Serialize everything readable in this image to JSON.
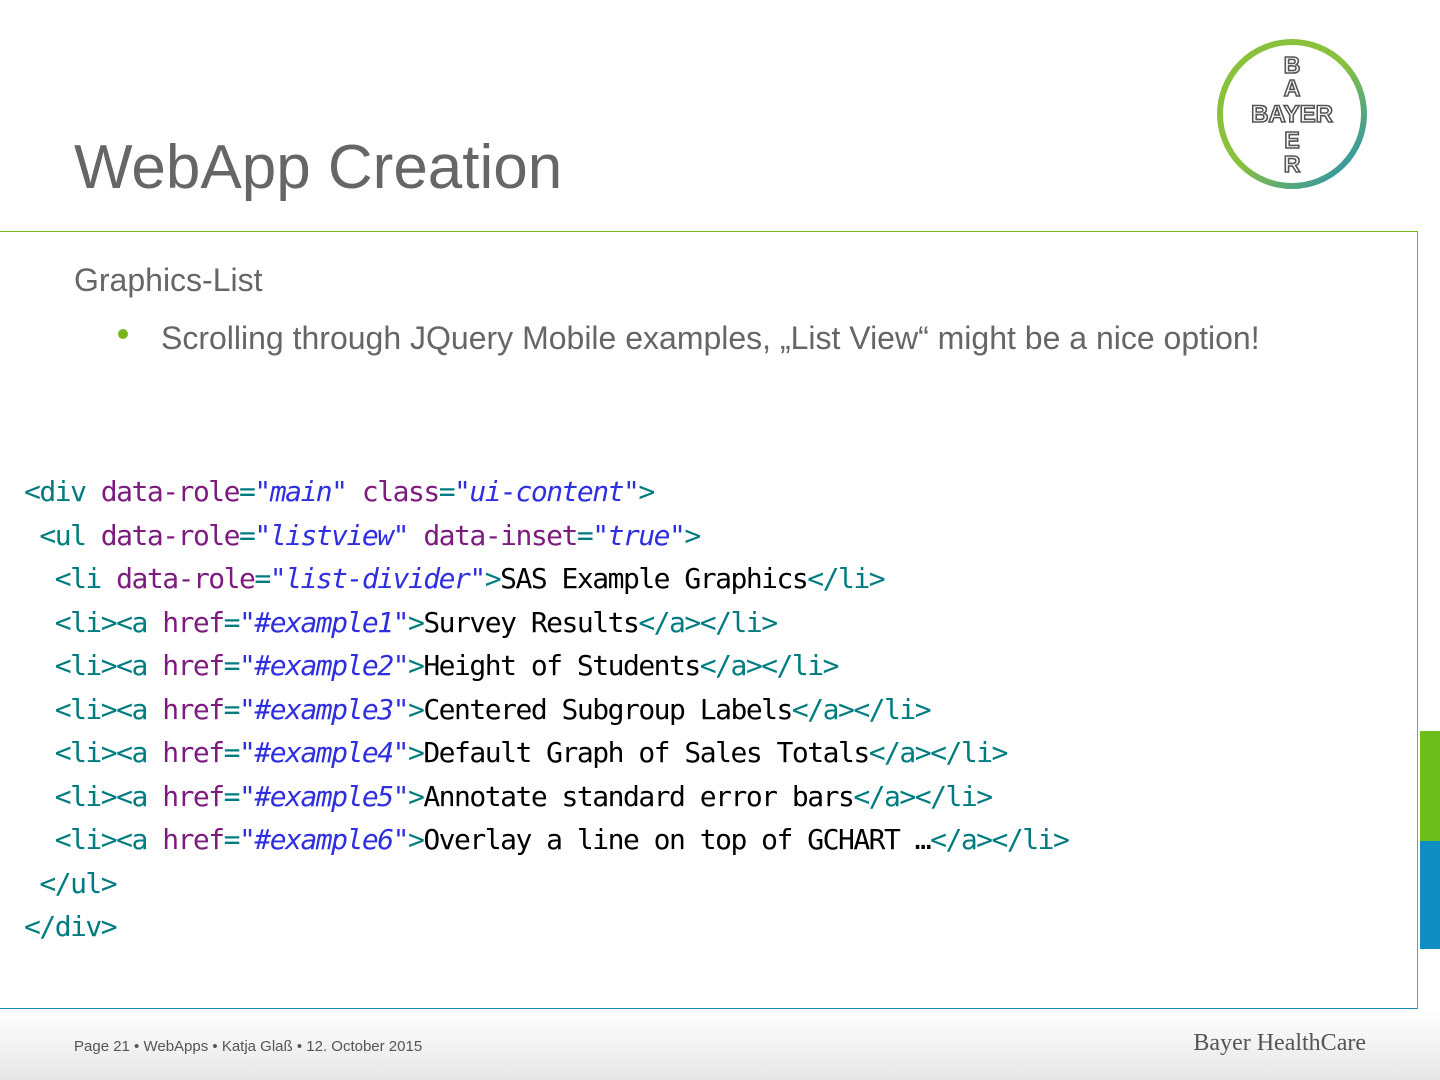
{
  "slide": {
    "title": "WebApp Creation",
    "subheading": "Graphics-List",
    "bullet": "Scrolling through JQuery Mobile examples, „List View“ might be a nice option!"
  },
  "logo": {
    "vertical_letters": [
      "B",
      "A",
      "E",
      "R"
    ],
    "horizontal": "BAYER",
    "colors": {
      "green": "#89c13d",
      "blue": "#1f8cc0",
      "text": "#555555"
    }
  },
  "code_lines": [
    [
      [
        "tag",
        "<div "
      ],
      [
        "attr",
        "data-role"
      ],
      [
        "tag",
        "="
      ],
      [
        "val",
        "\"main\""
      ],
      [
        "tag",
        " "
      ],
      [
        "attr",
        "class"
      ],
      [
        "tag",
        "="
      ],
      [
        "val",
        "\"ui-content\""
      ],
      [
        "tag",
        ">"
      ]
    ],
    [
      [
        "tag",
        " <ul "
      ],
      [
        "attr",
        "data-role"
      ],
      [
        "tag",
        "="
      ],
      [
        "val",
        "\"listview\""
      ],
      [
        "tag",
        " "
      ],
      [
        "attr",
        "data-inset"
      ],
      [
        "tag",
        "="
      ],
      [
        "val",
        "\"true\""
      ],
      [
        "tag",
        ">"
      ]
    ],
    [
      [
        "tag",
        "  <li "
      ],
      [
        "attr",
        "data-role"
      ],
      [
        "tag",
        "="
      ],
      [
        "val",
        "\"list-divider\""
      ],
      [
        "tag",
        ">"
      ],
      [
        "txt",
        "SAS Example Graphics"
      ],
      [
        "tag",
        "</li>"
      ]
    ],
    [
      [
        "tag",
        "  <li><a "
      ],
      [
        "attr",
        "href"
      ],
      [
        "tag",
        "="
      ],
      [
        "val",
        "\"#example1\""
      ],
      [
        "tag",
        ">"
      ],
      [
        "txt",
        "Survey Results"
      ],
      [
        "tag",
        "</a></li>"
      ]
    ],
    [
      [
        "tag",
        "  <li><a "
      ],
      [
        "attr",
        "href"
      ],
      [
        "tag",
        "="
      ],
      [
        "val",
        "\"#example2\""
      ],
      [
        "tag",
        ">"
      ],
      [
        "txt",
        "Height of Students"
      ],
      [
        "tag",
        "</a></li>"
      ]
    ],
    [
      [
        "tag",
        "  <li><a "
      ],
      [
        "attr",
        "href"
      ],
      [
        "tag",
        "="
      ],
      [
        "val",
        "\"#example3\""
      ],
      [
        "tag",
        ">"
      ],
      [
        "txt",
        "Centered Subgroup Labels"
      ],
      [
        "tag",
        "</a></li>"
      ]
    ],
    [
      [
        "tag",
        "  <li><a "
      ],
      [
        "attr",
        "href"
      ],
      [
        "tag",
        "="
      ],
      [
        "val",
        "\"#example4\""
      ],
      [
        "tag",
        ">"
      ],
      [
        "txt",
        "Default Graph of Sales Totals"
      ],
      [
        "tag",
        "</a></li>"
      ]
    ],
    [
      [
        "tag",
        "  <li><a "
      ],
      [
        "attr",
        "href"
      ],
      [
        "tag",
        "="
      ],
      [
        "val",
        "\"#example5\""
      ],
      [
        "tag",
        ">"
      ],
      [
        "txt",
        "Annotate standard error bars"
      ],
      [
        "tag",
        "</a></li>"
      ]
    ],
    [
      [
        "tag",
        "  <li><a "
      ],
      [
        "attr",
        "href"
      ],
      [
        "tag",
        "="
      ],
      [
        "val",
        "\"#example6\""
      ],
      [
        "tag",
        ">"
      ],
      [
        "txt",
        "Overlay a line on top of GCHART …"
      ],
      [
        "tag",
        "</a></li>"
      ]
    ],
    [
      [
        "tag",
        " </ul>"
      ]
    ],
    [
      [
        "tag",
        "</div>"
      ]
    ]
  ],
  "footer": {
    "info": "Page 21 • WebApps • Katja Glaß • 12. October 2015",
    "brand": "Bayer HealthCare"
  }
}
